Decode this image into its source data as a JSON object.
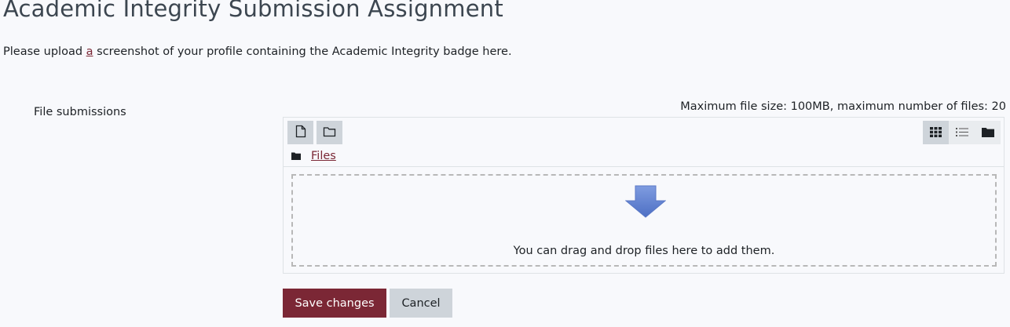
{
  "page": {
    "title": "Academic Integrity Submission Assignment",
    "intro_before": "Please upload ",
    "intro_link": "a",
    "intro_after": " screenshot of your profile containing the Academic Integrity badge here."
  },
  "form": {
    "field_label": "File submissions",
    "limits": "Maximum file size: 100MB, maximum number of files: 20"
  },
  "filemanager": {
    "toolbar": {
      "add_file_icon": "file-icon",
      "create_folder_icon": "folder-outline-icon",
      "views": [
        {
          "icon": "grid-icon",
          "active": true
        },
        {
          "icon": "list-icon",
          "active": false
        },
        {
          "icon": "folder-tree-icon",
          "active": false
        }
      ]
    },
    "path_label": "Files",
    "dropzone_text": "You can drag and drop files here to add them.",
    "dropzone_icon": "down-arrow-icon"
  },
  "actions": {
    "save_label": "Save changes",
    "cancel_label": "Cancel"
  },
  "colors": {
    "brand": "#7b2735",
    "background": "#f8f9fc",
    "button_secondary": "#ced4da",
    "arrow": "#6a8bd4"
  }
}
